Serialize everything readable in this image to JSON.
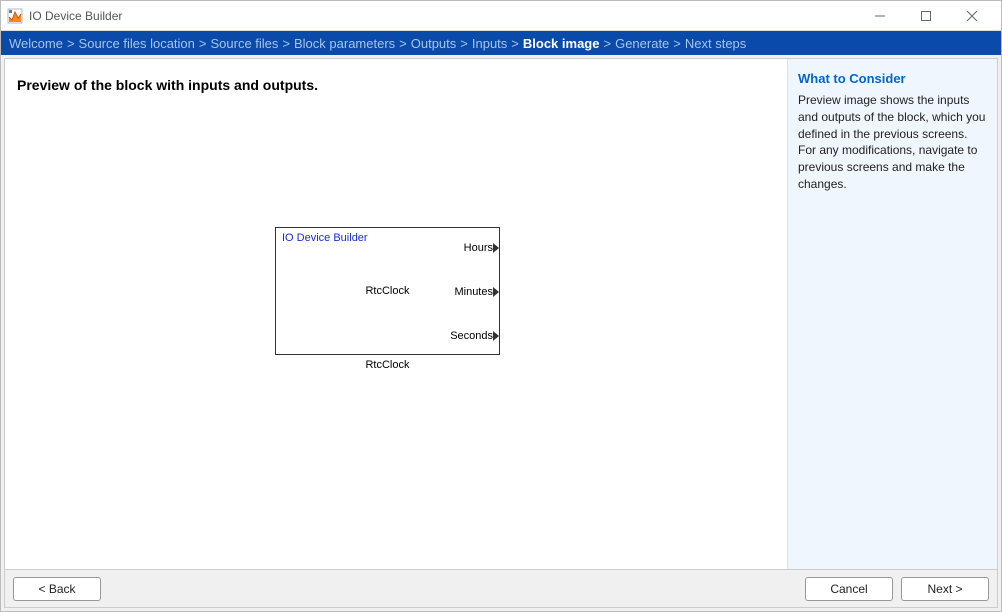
{
  "window": {
    "title": "IO Device Builder"
  },
  "breadcrumb": {
    "items": [
      {
        "label": "Welcome",
        "current": false
      },
      {
        "label": "Source files location",
        "current": false
      },
      {
        "label": "Source files",
        "current": false
      },
      {
        "label": "Block parameters",
        "current": false
      },
      {
        "label": "Outputs",
        "current": false
      },
      {
        "label": "Inputs",
        "current": false
      },
      {
        "label": "Block image",
        "current": true
      },
      {
        "label": "Generate",
        "current": false
      },
      {
        "label": "Next steps",
        "current": false
      }
    ]
  },
  "content": {
    "heading": "Preview of the block with inputs and outputs."
  },
  "block": {
    "name_top": "IO Device Builder",
    "name_center": "RtcClock",
    "caption": "RtcClock",
    "outputs": [
      {
        "label": "Hours"
      },
      {
        "label": "Minutes"
      },
      {
        "label": "Seconds"
      }
    ]
  },
  "side": {
    "title": "What to Consider",
    "text": "Preview image shows the inputs and outputs of the block, which you defined in the previous screens. For any modifications, navigate to previous screens and make the changes."
  },
  "footer": {
    "back": "< Back",
    "cancel": "Cancel",
    "next": "Next >"
  }
}
